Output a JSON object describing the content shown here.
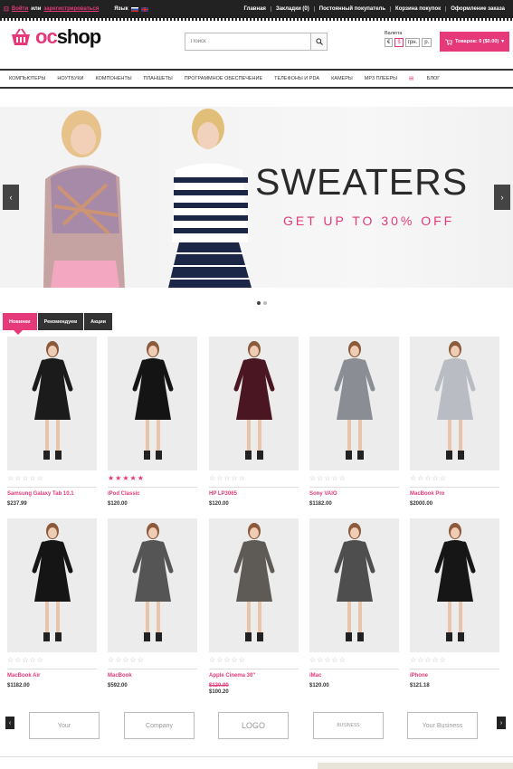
{
  "topbar": {
    "login": "Войти",
    "or": "или",
    "register": "зарегистрироваться",
    "language_label": "Язык",
    "links": [
      "Главная",
      "Закладки (0)",
      "Постоянный покупатель",
      "Корзина покупок",
      "Оформление заказа"
    ]
  },
  "header": {
    "logo_oc": "oc",
    "logo_shop": "shop",
    "search_placeholder": "Поиск",
    "currency_label": "Валюта",
    "currencies": [
      "€",
      "$",
      "грн.",
      "р."
    ],
    "active_currency": "$",
    "cart_label": "Товаров: 0 ($0.00)"
  },
  "nav": {
    "items": [
      "Компьютеры",
      "Ноутбуки",
      "Компоненты",
      "Планшеты",
      "Программное обеспечение",
      "Телефоны и PDA",
      "Камеры",
      "MP3 Плееры",
      "Блог"
    ]
  },
  "banner": {
    "headline": "SWEATERS",
    "subheadline": "GET UP TO 30% OFF",
    "prev": "‹",
    "next": "›"
  },
  "tabs": [
    "Новинки",
    "Рекомендуем",
    "Акции"
  ],
  "products": [
    {
      "name": "Samsung Galaxy Tab 10.1",
      "price": "$237.99",
      "rating": 0,
      "dress": "#1b1b1b"
    },
    {
      "name": "iPod Classic",
      "price": "$120.00",
      "rating": 5,
      "dress": "#141414"
    },
    {
      "name": "HP LP3065",
      "price": "$120.00",
      "rating": 0,
      "dress": "#4a1622"
    },
    {
      "name": "Sony VAIO",
      "price": "$1182.00",
      "rating": 0,
      "dress": "#8a8d94"
    },
    {
      "name": "MacBook Pro",
      "price": "$2000.00",
      "rating": 0,
      "dress": "#b9bcc2"
    },
    {
      "name": "MacBook Air",
      "price": "$1182.00",
      "rating": 0,
      "dress": "#151515"
    },
    {
      "name": "MacBook",
      "price": "$592.00",
      "rating": 0,
      "dress": "#555555"
    },
    {
      "name": "Apple Cinema 30\"",
      "price": "$100.20",
      "old_price": "$120.00",
      "rating": 0,
      "dress": "#5e5a55"
    },
    {
      "name": "iMac",
      "price": "$120.00",
      "rating": 0,
      "dress": "#4e4e4e"
    },
    {
      "name": "iPhone",
      "price": "$121.18",
      "rating": 0,
      "dress": "#161616"
    }
  ],
  "brands": [
    "Your",
    "Company",
    "LOGO",
    "BUSINESS",
    "Your Business"
  ],
  "colors": {
    "accent": "#e5397a",
    "dark": "#222222"
  }
}
